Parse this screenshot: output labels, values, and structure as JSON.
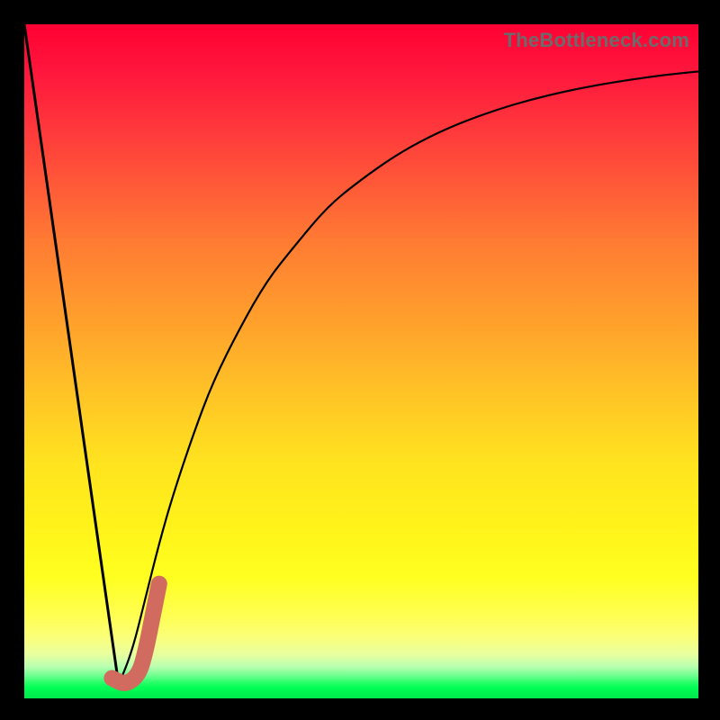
{
  "watermark": {
    "text": "TheBottleneck.com"
  },
  "colors": {
    "background": "#000000",
    "curve": "#000000",
    "highlight": "#d16a5f",
    "gradient_top": "#ff0033",
    "gradient_bottom": "#00e84c"
  },
  "chart_data": {
    "type": "line",
    "title": "",
    "xlabel": "",
    "ylabel": "",
    "xlim": [
      0,
      100
    ],
    "ylim": [
      0,
      100
    ],
    "grid": false,
    "legend": false,
    "series": [
      {
        "name": "left-descent",
        "x": [
          0,
          14
        ],
        "values": [
          100,
          2
        ]
      },
      {
        "name": "recovery-curve",
        "x": [
          14,
          16,
          18,
          20,
          22,
          25,
          28,
          32,
          36,
          40,
          45,
          50,
          55,
          60,
          65,
          70,
          75,
          80,
          85,
          90,
          95,
          100
        ],
        "values": [
          2,
          7,
          15,
          23,
          30,
          39,
          47,
          55,
          62,
          67,
          73,
          77,
          80.5,
          83.3,
          85.5,
          87.3,
          88.8,
          90,
          91,
          91.8,
          92.5,
          93
        ]
      },
      {
        "name": "highlight-hook",
        "x": [
          13,
          15,
          17,
          18,
          19,
          20
        ],
        "values": [
          3,
          2,
          3.5,
          7,
          12,
          17
        ]
      }
    ]
  }
}
